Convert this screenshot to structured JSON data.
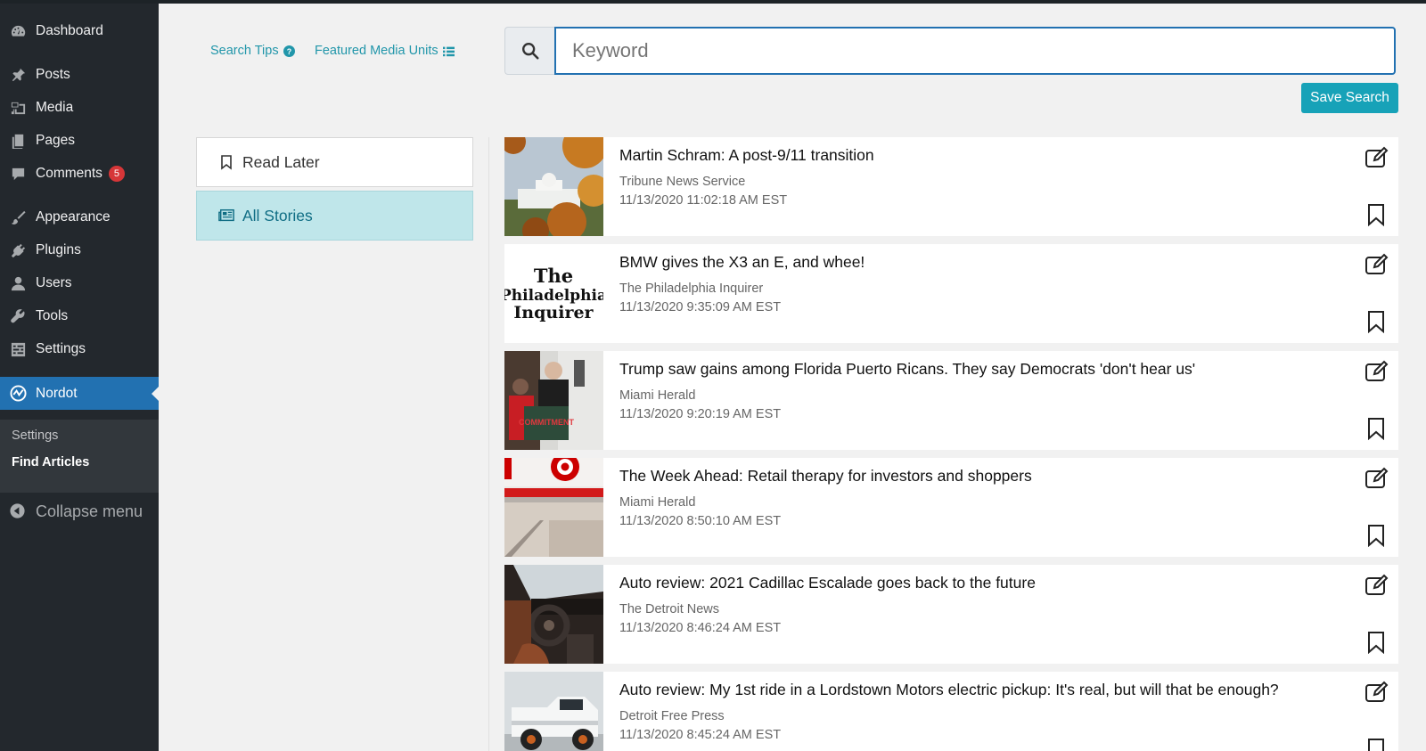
{
  "sidebar": {
    "items": [
      {
        "label": "Dashboard",
        "icon": "dashboard-icon"
      },
      {
        "label": "Posts",
        "icon": "pin-icon"
      },
      {
        "label": "Media",
        "icon": "media-icon"
      },
      {
        "label": "Pages",
        "icon": "pages-icon"
      },
      {
        "label": "Comments",
        "icon": "comment-icon",
        "badge": "5"
      },
      {
        "label": "Appearance",
        "icon": "brush-icon"
      },
      {
        "label": "Plugins",
        "icon": "plug-icon"
      },
      {
        "label": "Users",
        "icon": "user-icon"
      },
      {
        "label": "Tools",
        "icon": "wrench-icon"
      },
      {
        "label": "Settings",
        "icon": "settings-sliders-icon"
      },
      {
        "label": "Nordot",
        "icon": "nordot-logo-icon",
        "active": true
      }
    ],
    "submenu": [
      {
        "label": "Settings"
      },
      {
        "label": "Find Articles",
        "current": true
      }
    ],
    "collapse_label": "Collapse menu"
  },
  "header": {
    "search_tips": "Search Tips",
    "featured_units": "Featured Media Units"
  },
  "search": {
    "placeholder": "Keyword",
    "value": "",
    "save_label": "Save Search"
  },
  "filters": {
    "read_later": "Read Later",
    "all_stories": "All Stories"
  },
  "articles": [
    {
      "title": "Martin Schram: A post-9/11 transition",
      "source": "Tribune News Service",
      "date": "11/13/2020 11:02:18 AM EST",
      "thumb": "white-house-autumn"
    },
    {
      "title": "BMW gives the X3 an E, and whee!",
      "source": "The Philadelphia Inquirer",
      "date": "11/13/2020 9:35:09 AM EST",
      "thumb": "philadelphia-inquirer-logo",
      "thumb_text": [
        "The",
        "Philadelphia",
        "Inquirer"
      ]
    },
    {
      "title": "Trump saw gains among Florida Puerto Ricans. They say Democrats 'don't hear us'",
      "source": "Miami Herald",
      "date": "11/13/2020 9:20:19 AM EST",
      "thumb": "rally-podium",
      "thumb_text": [
        "COMMITMENT"
      ]
    },
    {
      "title": "The Week Ahead: Retail therapy for investors and shoppers",
      "source": "Miami Herald",
      "date": "11/13/2020 8:50:10 AM EST",
      "thumb": "target-store"
    },
    {
      "title": "Auto review: 2021 Cadillac Escalade goes back to the future",
      "source": "The Detroit News",
      "date": "11/13/2020 8:46:24 AM EST",
      "thumb": "car-interior"
    },
    {
      "title": "Auto review: My 1st ride in a Lordstown Motors electric pickup: It's real, but will that be enough?",
      "source": "Detroit Free Press",
      "date": "11/13/2020 8:45:24 AM EST",
      "thumb": "white-pickup"
    }
  ]
}
